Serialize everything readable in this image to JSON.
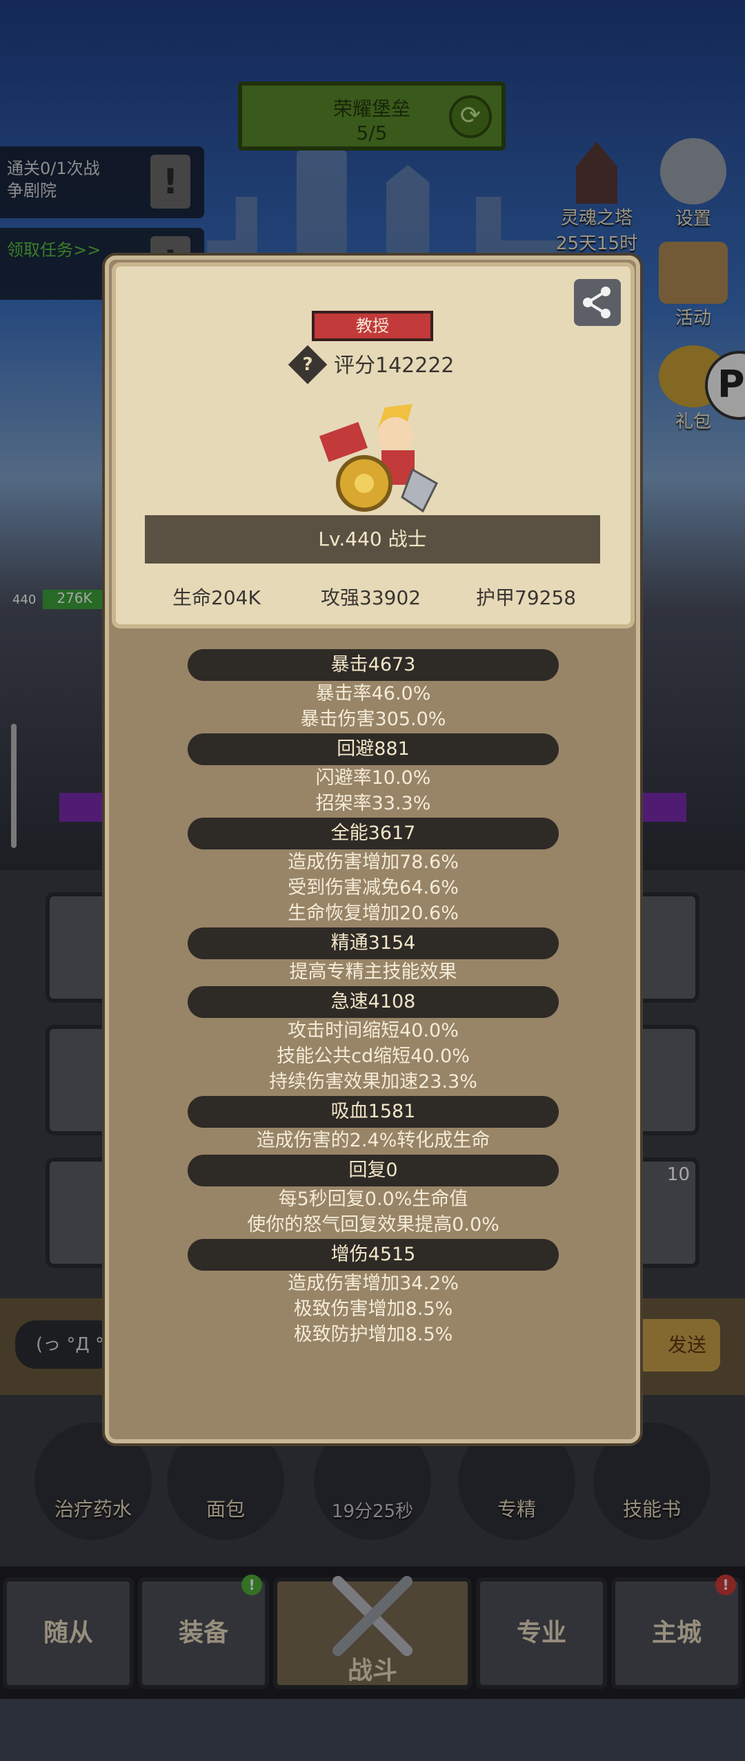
{
  "stage": {
    "title": "荣耀堡垒",
    "progress": "5/5"
  },
  "quests": [
    {
      "text_line1": "通关0/1次战",
      "text_line2": "争剧院"
    },
    {
      "text_line1": "领取任务>>",
      "text_line2": ""
    }
  ],
  "side": {
    "tower_label": "灵魂之塔",
    "tower_time": "25天15时",
    "settings_label": "设置",
    "activity_label": "活动",
    "gift_label": "礼包"
  },
  "float_button": "P",
  "unit": {
    "level": "440",
    "hp": "276K"
  },
  "chat_preview": "(っ °Д °",
  "send_label": "发送",
  "consumables": [
    {
      "label": "治疗药水"
    },
    {
      "label": "面包"
    },
    {
      "label": "19分25秒"
    },
    {
      "label": "专精"
    },
    {
      "label": "技能书"
    }
  ],
  "slot_badge": "10",
  "tabs": [
    {
      "label": "随从"
    },
    {
      "label": "装备"
    },
    {
      "label": "战斗"
    },
    {
      "label": "专业"
    },
    {
      "label": "主城"
    }
  ],
  "popup": {
    "rank": "教授",
    "score": "评分142222",
    "level_class": "Lv.440 战士",
    "hp": "生命204K",
    "attack": "攻强33902",
    "armor": "护甲79258",
    "sections": [
      {
        "head": "暴击4673",
        "lines": [
          "暴击率46.0%",
          "暴击伤害305.0%"
        ]
      },
      {
        "head": "回避881",
        "lines": [
          "闪避率10.0%",
          "招架率33.3%"
        ]
      },
      {
        "head": "全能3617",
        "lines": [
          "造成伤害增加78.6%",
          "受到伤害减免64.6%",
          "生命恢复增加20.6%"
        ]
      },
      {
        "head": "精通3154",
        "lines": [
          "提高专精主技能效果"
        ]
      },
      {
        "head": "急速4108",
        "lines": [
          "攻击时间缩短40.0%",
          "技能公共cd缩短40.0%",
          "持续伤害效果加速23.3%"
        ]
      },
      {
        "head": "吸血1581",
        "lines": [
          "造成伤害的2.4%转化成生命"
        ]
      },
      {
        "head": "回复0",
        "lines": [
          "每5秒回复0.0%生命值",
          "使你的怒气回复效果提高0.0%"
        ]
      },
      {
        "head": "增伤4515",
        "lines": [
          "造成伤害增加34.2%",
          "极致伤害增加8.5%",
          "极致防护增加8.5%"
        ]
      }
    ]
  },
  "colors": {
    "rank_badge": "#c23a3a",
    "stage_banner": "#5a8a2c",
    "popup_bg": "#988467",
    "parchment": "#e6d9b8"
  }
}
